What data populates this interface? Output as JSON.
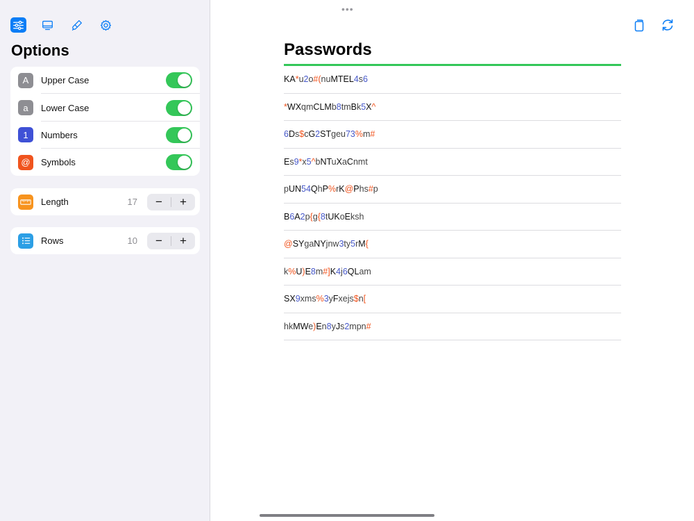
{
  "sidebar": {
    "toolbar": [
      {
        "name": "sliders-icon",
        "active": true
      },
      {
        "name": "display-icon",
        "active": false
      },
      {
        "name": "brush-icon",
        "active": false
      },
      {
        "name": "gear-icon",
        "active": false
      }
    ],
    "title": "Options",
    "toggles": [
      {
        "icon_text": "A",
        "icon_color": "#8e8e93",
        "label": "Upper Case",
        "on": true
      },
      {
        "icon_text": "a",
        "icon_color": "#8e8e93",
        "label": "Lower Case",
        "on": true
      },
      {
        "icon_text": "1",
        "icon_color": "#3f51d6",
        "label": "Numbers",
        "on": true
      },
      {
        "icon_text": "@",
        "icon_color": "#f0541e",
        "label": "Symbols",
        "on": true
      }
    ],
    "length": {
      "label": "Length",
      "value": "17",
      "icon": "ruler-icon",
      "icon_color": "#f7931e"
    },
    "rows": {
      "label": "Rows",
      "value": "10",
      "icon": "list-icon",
      "icon_color": "#2c9fe5"
    },
    "stepper": {
      "minus": "−",
      "plus": "+"
    }
  },
  "main": {
    "dots": "•••",
    "title": "Passwords",
    "accent_color": "#34c759",
    "passwords": [
      "KA*u2o#(nuMTEL4s6",
      "*WXqmCLMb8tmBk5X^",
      "6Ds$cG2STgeu73%m#",
      "Es9*x5^bNTuXaCnmt",
      "pUN54QhP%rK@Phs#p",
      "B6A2p{g{8tUKoEksh",
      "@SYgaNYjnw3ty5rM{",
      "k%U)E8m#]K4j6QLam",
      "SX9xms%3yFxejs$n[",
      "hkMWe)En8yJs2mpn#"
    ]
  },
  "colors": {
    "uppercase": "#111111",
    "lowercase": "#444444",
    "number": "#4759c9",
    "symbol": "#f0541e"
  }
}
